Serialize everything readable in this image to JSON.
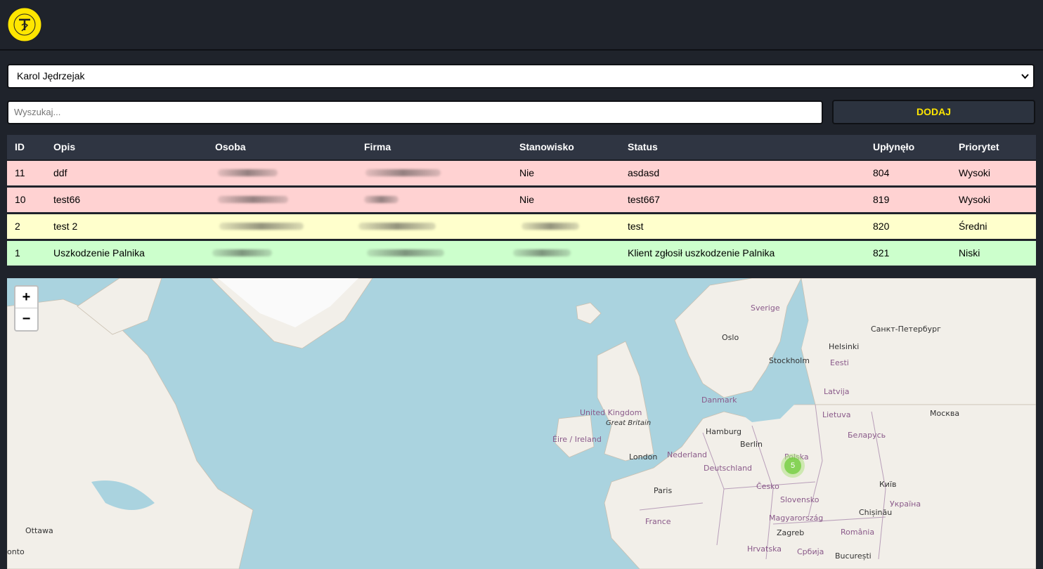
{
  "header": {
    "logo_icon": "technika-spawalnicza-logo"
  },
  "person_select": {
    "selected": "Karol Jędrzejak"
  },
  "search": {
    "placeholder": "Wyszukaj..."
  },
  "add_button": {
    "label": "DODAJ"
  },
  "table": {
    "headers": [
      "ID",
      "Opis",
      "Osoba",
      "Firma",
      "Stanowisko",
      "Status",
      "Upłynęło",
      "Priorytet"
    ],
    "rows": [
      {
        "id": "11",
        "opis": "ddf",
        "stanowisko": "Nie",
        "status": "asdasd",
        "uplynelo": "804",
        "priorytet": "Wysoki",
        "level": "high"
      },
      {
        "id": "10",
        "opis": "test66",
        "stanowisko": "Nie",
        "status": "test667",
        "uplynelo": "819",
        "priorytet": "Wysoki",
        "level": "high"
      },
      {
        "id": "2",
        "opis": "test 2",
        "stanowisko": "",
        "status": "test",
        "uplynelo": "820",
        "priorytet": "Średni",
        "level": "medium"
      },
      {
        "id": "1",
        "opis": "Uszkodzenie Palnika",
        "stanowisko": "",
        "status": "Klient zgłosił uszkodzenie Palnika",
        "uplynelo": "821",
        "priorytet": "Niski",
        "level": "low"
      }
    ]
  },
  "map": {
    "zoom_in": "+",
    "zoom_out": "−",
    "cluster_count": "5",
    "labels": {
      "sverige": "Sverige",
      "oslo": "Oslo",
      "helsinki": "Helsinki",
      "spb": "Санкт-Петербург",
      "stockholm": "Stockholm",
      "eesti": "Eesti",
      "latvija": "Latvija",
      "danmark": "Danmark",
      "uk": "United Kingdom",
      "gb": "Great Britain",
      "lietuva": "Lietuva",
      "moskva": "Москва",
      "hamburg": "Hamburg",
      "eire": "Éire / Ireland",
      "berlin": "Berlin",
      "belarus": "Беларусь",
      "nederland": "Nederland",
      "london": "London",
      "polska": "Polska",
      "deutschland": "Deutschland",
      "kyiv": "Київ",
      "cesko": "Česko",
      "paris": "Paris",
      "slovensko": "Slovensko",
      "ukraina": "Україна",
      "france": "France",
      "chisinau": "Chișinău",
      "magyarorszag": "Magyarország",
      "ottawa": "Ottawa",
      "zagreb": "Zagreb",
      "romania": "România",
      "onto": "onto",
      "hrvatska": "Hrvatska",
      "srbija": "Србија",
      "bucuresti": "București"
    }
  }
}
